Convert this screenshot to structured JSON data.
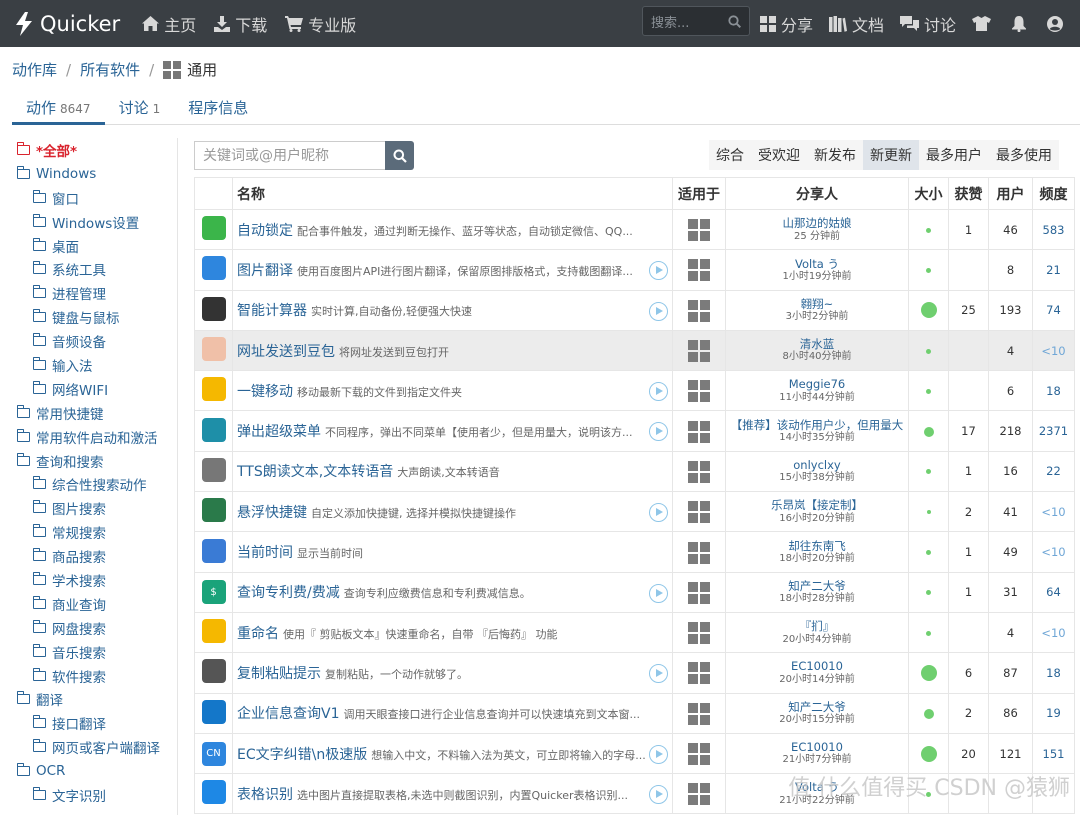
{
  "brand": "Quicker",
  "nav": {
    "home": "主页",
    "download": "下载",
    "pro": "专业版",
    "share": "分享",
    "docs": "文档",
    "discuss": "讨论"
  },
  "search_placeholder": "搜索...",
  "breadcrumb": {
    "root": "动作库",
    "software": "所有软件",
    "current": "通用"
  },
  "tabs": {
    "actions_label": "动作",
    "actions_count": "8647",
    "discuss_label": "讨论",
    "discuss_count": "1",
    "info_label": "程序信息"
  },
  "sidebar": [
    {
      "label": "*全部*",
      "level": 0,
      "active": true
    },
    {
      "label": "Windows",
      "level": 0
    },
    {
      "label": "窗口",
      "level": 1
    },
    {
      "label": "Windows设置",
      "level": 1
    },
    {
      "label": "桌面",
      "level": 1
    },
    {
      "label": "系统工具",
      "level": 1
    },
    {
      "label": "进程管理",
      "level": 1
    },
    {
      "label": "键盘与鼠标",
      "level": 1
    },
    {
      "label": "音频设备",
      "level": 1
    },
    {
      "label": "输入法",
      "level": 1
    },
    {
      "label": "网络WIFI",
      "level": 1
    },
    {
      "label": "常用快捷键",
      "level": 0
    },
    {
      "label": "常用软件启动和激活",
      "level": 0
    },
    {
      "label": "查询和搜索",
      "level": 0
    },
    {
      "label": "综合性搜索动作",
      "level": 1
    },
    {
      "label": "图片搜索",
      "level": 1
    },
    {
      "label": "常规搜索",
      "level": 1
    },
    {
      "label": "商品搜索",
      "level": 1
    },
    {
      "label": "学术搜索",
      "level": 1
    },
    {
      "label": "商业查询",
      "level": 1
    },
    {
      "label": "网盘搜索",
      "level": 1
    },
    {
      "label": "音乐搜索",
      "level": 1
    },
    {
      "label": "软件搜索",
      "level": 1
    },
    {
      "label": "翻译",
      "level": 0
    },
    {
      "label": "接口翻译",
      "level": 1
    },
    {
      "label": "网页或客户端翻译",
      "level": 1
    },
    {
      "label": "OCR",
      "level": 0
    },
    {
      "label": "文字识别",
      "level": 1
    }
  ],
  "keyword_placeholder": "关键词或@用户昵称",
  "sorts": [
    {
      "label": "综合"
    },
    {
      "label": "受欢迎"
    },
    {
      "label": "新发布"
    },
    {
      "label": "新更新",
      "active": true
    },
    {
      "label": "最多用户"
    },
    {
      "label": "最多使用"
    }
  ],
  "columns": {
    "name": "名称",
    "platform": "适用于",
    "sharer": "分享人",
    "size": "大小",
    "likes": "获赞",
    "users": "用户",
    "freq": "频度"
  },
  "rows": [
    {
      "icon": "wechat-icon",
      "color": "#3bb54a",
      "glyph": "",
      "name": "自动锁定",
      "desc": "配合事件触发，通过判断无操作、蓝牙等状态，自动锁定微信、QQ...",
      "play": false,
      "sharer": "山那边的姑娘",
      "time": "25 分钟前",
      "size": "small",
      "likes": "1",
      "users": "46",
      "freq": "583",
      "low": false
    },
    {
      "icon": "image-translate-icon",
      "color": "#2e86de",
      "glyph": "",
      "name": "图片翻译",
      "desc": "使用百度图片API进行图片翻译，保留原图排版格式，支持截图翻译...",
      "play": true,
      "sharer": "Volta う",
      "time": "1小时19分钟前",
      "size": "small",
      "likes": "",
      "users": "8",
      "freq": "21",
      "low": false
    },
    {
      "icon": "calculator-icon",
      "color": "#333333",
      "glyph": "",
      "name": "智能计算器",
      "desc": "实时计算,自动备份,轻便强大快速",
      "play": true,
      "sharer": "翱翔~",
      "time": "3小时2分钟前",
      "size": "large",
      "likes": "25",
      "users": "193",
      "freq": "74",
      "low": false
    },
    {
      "icon": "avatar-icon",
      "color": "#f0c0a8",
      "glyph": "",
      "name": "网址发送到豆包",
      "desc": "将网址发送到豆包打开",
      "play": false,
      "sharer": "清水蓝",
      "time": "8小时40分钟前",
      "size": "small",
      "likes": "",
      "users": "4",
      "freq": "<10",
      "low": true,
      "highlight": true
    },
    {
      "icon": "folder-move-icon",
      "color": "#f5b800",
      "glyph": "",
      "name": "一键移动",
      "desc": "移动最新下载的文件到指定文件夹",
      "play": true,
      "sharer": "Meggie76",
      "time": "11小时44分钟前",
      "size": "small",
      "likes": "",
      "users": "6",
      "freq": "18",
      "low": false
    },
    {
      "icon": "eject-icon",
      "color": "#1e8fa8",
      "glyph": "",
      "name": "弹出超级菜单",
      "desc": "不同程序，弹出不同菜单【使用者少，但是用量大，说明该方...",
      "play": true,
      "sharer": "【推荐】该动作用户少，但用量大",
      "time": "14小时35分钟前",
      "size": "medium",
      "likes": "17",
      "users": "218",
      "freq": "2371",
      "low": false
    },
    {
      "icon": "share-arrow-icon",
      "color": "#777777",
      "glyph": "",
      "name": "TTS朗读文本,文本转语音",
      "desc": "大声朗读,文本转语音",
      "play": false,
      "sharer": "onlyclxy",
      "time": "15小时38分钟前",
      "size": "small",
      "likes": "1",
      "users": "16",
      "freq": "22",
      "low": false
    },
    {
      "icon": "keyboard-icon",
      "color": "#2a7a4a",
      "glyph": "",
      "name": "悬浮快捷键",
      "desc": "自定义添加快捷键, 选择并模拟快捷键操作",
      "play": true,
      "sharer": "乐昂岚【接定制】",
      "time": "16小时20分钟前",
      "size": "tiny",
      "likes": "2",
      "users": "41",
      "freq": "<10",
      "low": true
    },
    {
      "icon": "clock-icon",
      "color": "#3a7bd5",
      "glyph": "",
      "name": "当前时间",
      "desc": "显示当前时间",
      "play": false,
      "sharer": "却往东南飞",
      "time": "18小时20分钟前",
      "size": "small",
      "likes": "1",
      "users": "49",
      "freq": "<10",
      "low": true
    },
    {
      "icon": "dollar-icon",
      "color": "#1aa37a",
      "glyph": "$",
      "name": "查询专利费/费减",
      "desc": "查询专利应缴费信息和专利费减信息。",
      "play": true,
      "sharer": "知产二大爷",
      "time": "18小时28分钟前",
      "size": "small",
      "likes": "1",
      "users": "31",
      "freq": "64",
      "low": false
    },
    {
      "icon": "rename-icon",
      "color": "#f5b800",
      "glyph": "",
      "name": "重命名",
      "desc": "使用『 剪贴板文本』快速重命名，自带 『后悔药』 功能",
      "play": false,
      "sharer": "『扪』",
      "time": "20小时4分钟前",
      "size": "small",
      "likes": "",
      "users": "4",
      "freq": "<10",
      "low": true
    },
    {
      "icon": "paste-icon",
      "color": "#555555",
      "glyph": "",
      "name": "复制粘贴提示",
      "desc": "复制粘贴，一个动作就够了。",
      "play": true,
      "sharer": "EC10010",
      "time": "20小时14分钟前",
      "size": "large",
      "likes": "6",
      "users": "87",
      "freq": "18",
      "low": false
    },
    {
      "icon": "edge-icon",
      "color": "#1477c9",
      "glyph": "",
      "name": "企业信息查询V1",
      "desc": "调用天眼查接口进行企业信息查询并可以快速填充到文本窗...",
      "play": false,
      "sharer": "知产二大爷",
      "time": "20小时15分钟前",
      "size": "medium",
      "likes": "2",
      "users": "86",
      "freq": "19",
      "low": false
    },
    {
      "icon": "cn-text-icon",
      "color": "#2e86de",
      "glyph": "CN",
      "name": "EC文字纠错\\n极速版",
      "desc": "想输入中文，不料输入法为英文，可立即将输入的字母...",
      "play": true,
      "sharer": "EC10010",
      "time": "21小时7分钟前",
      "size": "large",
      "likes": "20",
      "users": "121",
      "freq": "151",
      "low": false
    },
    {
      "icon": "table-ocr-icon",
      "color": "#1e88e5",
      "glyph": "",
      "name": "表格识别",
      "desc": "选中图片直接提取表格,未选中则截图识别，内置Quicker表格识别...",
      "play": true,
      "sharer": "Volta う",
      "time": "21小时22分钟前",
      "size": "small",
      "likes": "",
      "users": "",
      "freq": "",
      "low": false
    }
  ],
  "watermark": "值 什么值得买 CSDN @猿狮"
}
